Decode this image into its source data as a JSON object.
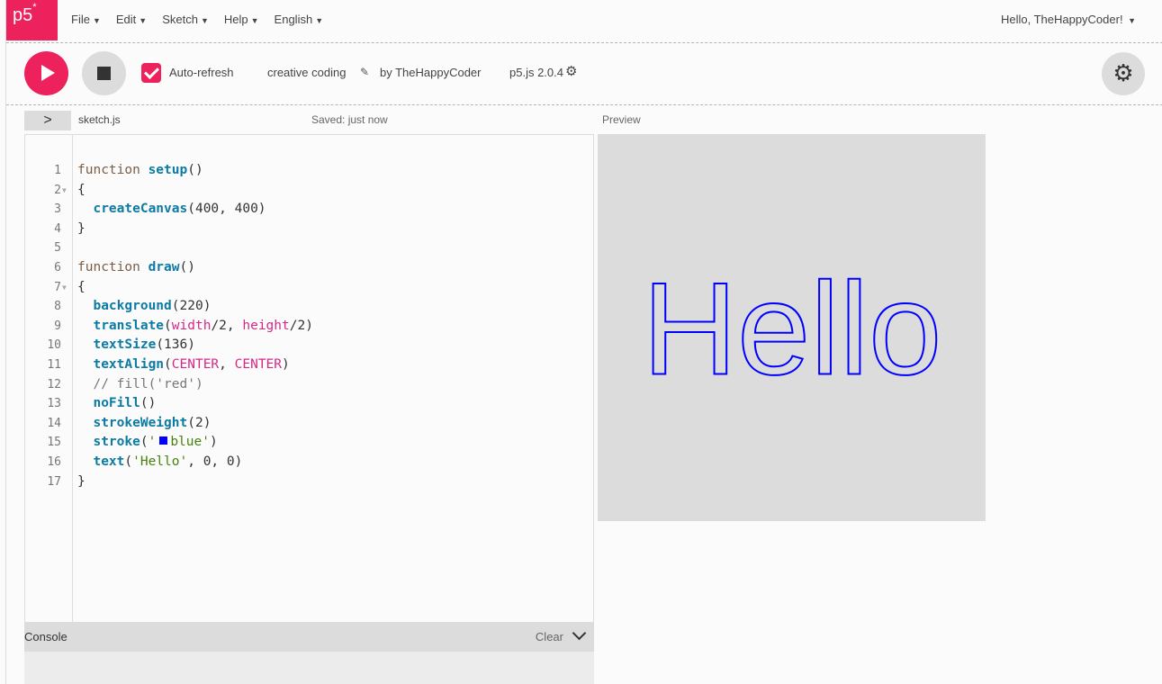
{
  "nav": {
    "logo": "p5",
    "logo_sup": "*",
    "menu": [
      "File",
      "Edit",
      "Sketch",
      "Help",
      "English"
    ],
    "user": "Hello, TheHappyCoder!"
  },
  "toolbar": {
    "auto_refresh_label": "Auto-refresh",
    "sketch_name": "creative coding",
    "by": "by TheHappyCoder",
    "version": "p5.js 2.0.4"
  },
  "editor": {
    "file_name": "sketch.js",
    "saved": "Saved: just now",
    "preview_label": "Preview",
    "lines": [
      "function setup()",
      "{",
      "  createCanvas(400, 400)",
      "}",
      "",
      "function draw()",
      "{",
      "  background(220)",
      "  translate(width/2, height/2)",
      "  textSize(136)",
      "  textAlign(CENTER, CENTER)",
      "  // fill('red')",
      "  noFill()",
      "  strokeWeight(2)",
      "  stroke('blue')",
      "  text('Hello', 0, 0)",
      "}"
    ]
  },
  "console": {
    "title": "Console",
    "clear": "Clear"
  },
  "preview": {
    "text": "Hello",
    "stroke_color": "#0000ff",
    "background": "#dcdcdc"
  },
  "colors": {
    "accent": "#ed225d"
  }
}
